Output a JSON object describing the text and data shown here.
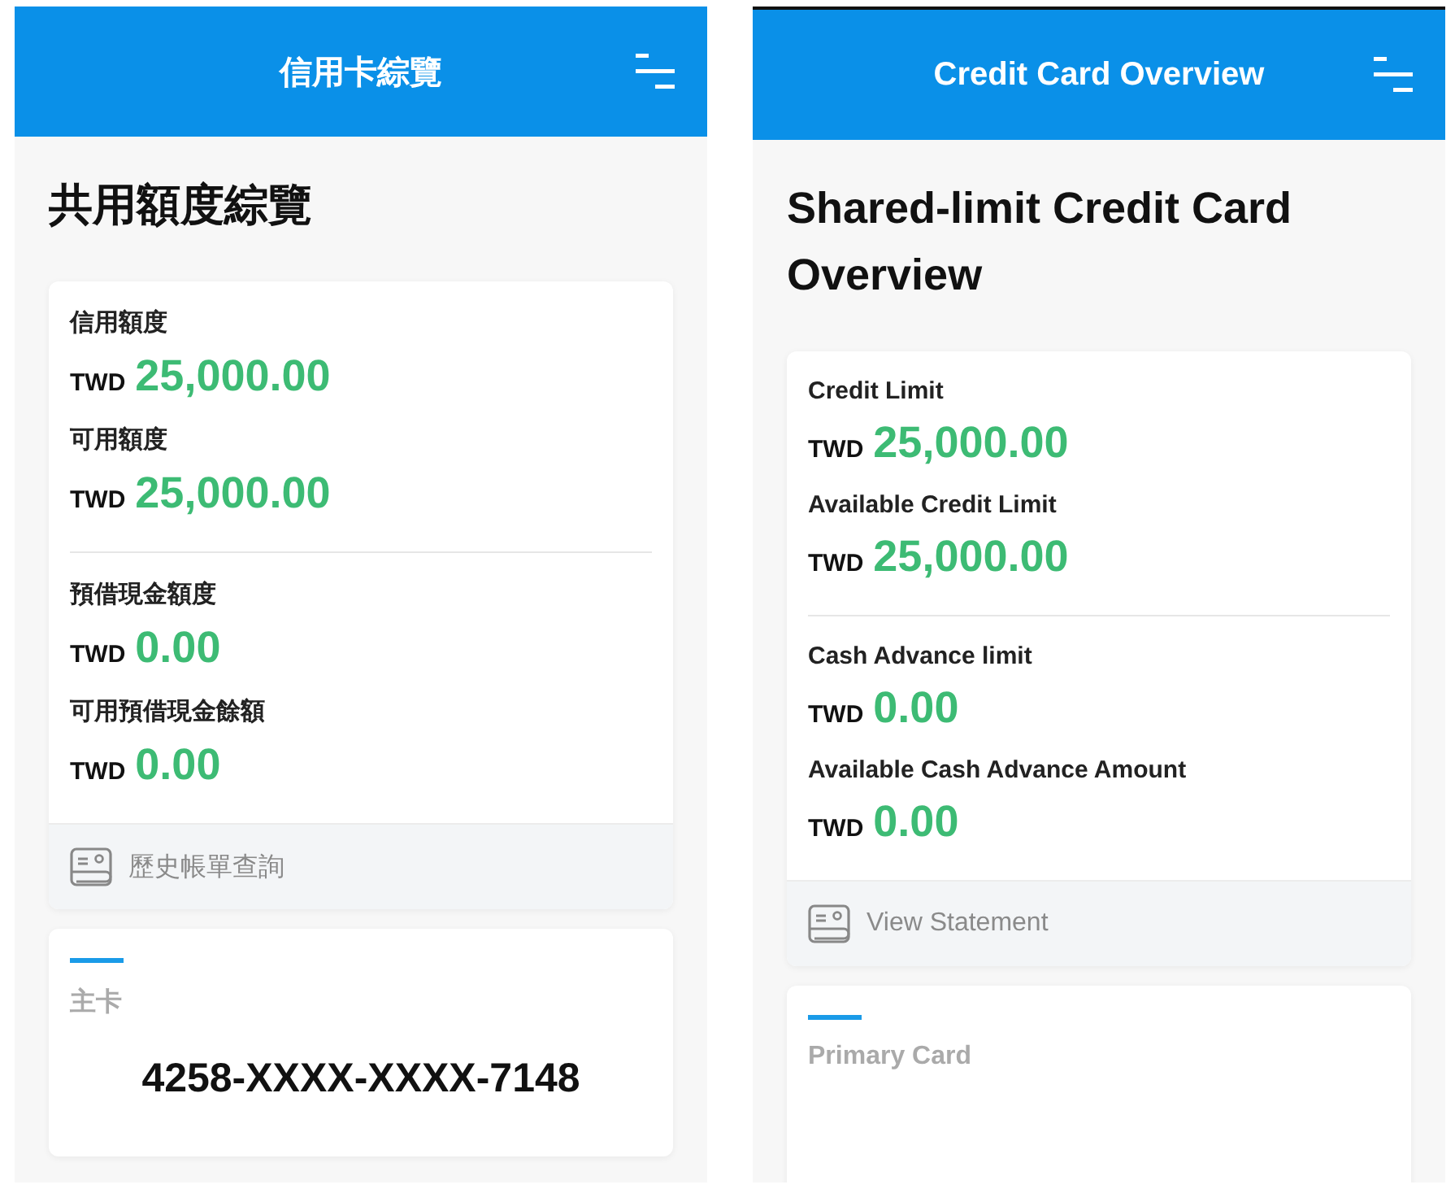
{
  "screens": [
    {
      "header_title": "信用卡綜覽",
      "page_title": "共用額度綜覽",
      "limit_groups": [
        [
          {
            "label": "信用額度",
            "currency": "TWD",
            "amount": "25,000.00"
          },
          {
            "label": "可用額度",
            "currency": "TWD",
            "amount": "25,000.00"
          }
        ],
        [
          {
            "label": "預借現金額度",
            "currency": "TWD",
            "amount": "0.00"
          },
          {
            "label": "可用預借現金餘額",
            "currency": "TWD",
            "amount": "0.00"
          }
        ]
      ],
      "statement_link": "歷史帳單查詢",
      "card": {
        "label": "主卡",
        "number": "4258-XXXX-XXXX-7148"
      }
    },
    {
      "header_title": "Credit Card Overview",
      "page_title": "Shared-limit Credit Card Overview",
      "limit_groups": [
        [
          {
            "label": "Credit Limit",
            "currency": "TWD",
            "amount": "25,000.00"
          },
          {
            "label": "Available Credit Limit",
            "currency": "TWD",
            "amount": "25,000.00"
          }
        ],
        [
          {
            "label": "Cash Advance limit",
            "currency": "TWD",
            "amount": "0.00"
          },
          {
            "label": "Available Cash Advance Amount",
            "currency": "TWD",
            "amount": "0.00"
          }
        ]
      ],
      "statement_link": "View Statement",
      "card": {
        "label": "Primary Card"
      }
    }
  ]
}
